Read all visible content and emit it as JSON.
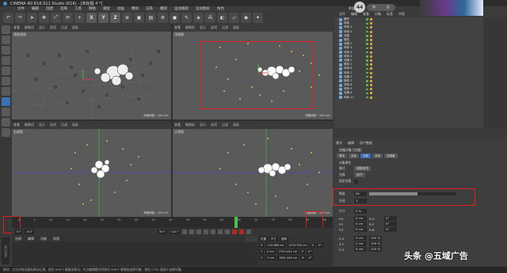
{
  "title": "CINEMA 4D R16.011 Studio (R16) - [未标题 4 *]",
  "menu": [
    "文件",
    "编辑",
    "创建",
    "选择",
    "工具",
    "网格",
    "捕捉",
    "动画",
    "模拟",
    "渲染",
    "雕刻",
    "运动跟踪",
    "运动图形",
    "角色",
    "流水线",
    "插件",
    "脚本",
    "窗口",
    "帮助"
  ],
  "toolbar": {
    "x": "X",
    "y": "Y",
    "z": "Z"
  },
  "viewports": [
    {
      "name": "透视视图",
      "grid": "网格间距 : 100 cm"
    },
    {
      "name": "顶视图",
      "grid": "网格间距 : 100 cm"
    },
    {
      "name": "右视图",
      "grid": "网格间距 : 100 cm"
    },
    {
      "name": "正视图",
      "grid": "网格间距 : 100 cm"
    }
  ],
  "viewport_menu": [
    "查看",
    "摄像机",
    "显示",
    "选项",
    "过滤",
    "面板"
  ],
  "timeline_ticks": [
    "0",
    "5",
    "10",
    "15",
    "20",
    "25",
    "30",
    "35",
    "40",
    "45",
    "50",
    "55",
    "60",
    "65",
    "70",
    "75",
    "80",
    "85",
    "90"
  ],
  "playback": {
    "start": "0 F",
    "current": "40 F",
    "end": "90 F",
    "fps": "120 F"
  },
  "materials_menu": [
    "创建",
    "编辑",
    "功能",
    "纹理"
  ],
  "coords": {
    "header": [
      "位置",
      "尺寸",
      "旋转"
    ],
    "rows": [
      [
        "X",
        "134.988 cm",
        "1070.935 cm",
        "H",
        "0°"
      ],
      [
        "Y",
        "0 cm",
        "2310.424 cm",
        "P",
        "0°"
      ],
      [
        "Z",
        "0 cm",
        "1651.449 cm",
        "B",
        "0°"
      ]
    ]
  },
  "status": "移动：点击并拖动鼠标移动元素。按住 SHIFT 键量化移动；节点编辑模式时按住 SHIFT 键增加选择对象；按住 CTRL 键减少选择对象。",
  "right_top": {
    "layout": "界面",
    "circle": "44",
    "pill": [
      "快",
      "加"
    ],
    "obj_menu": [
      "文件",
      "编辑",
      "查看",
      "对象",
      "标签",
      "书签"
    ]
  },
  "objects": [
    "圆环",
    "球体",
    "球体.1",
    "球体.2",
    "克隆",
    "随机",
    "克隆.1",
    "球体.3",
    "球体.4",
    "球体.5",
    "克隆.2",
    "随机.1",
    "球体.6",
    "球体.7",
    "克隆.3",
    "随机.2",
    "球体.8",
    "球体.9",
    "克隆.4",
    "球体.10"
  ],
  "attributes": {
    "menu": [
      "模式",
      "编辑",
      "用户数据"
    ],
    "name": "克隆对象 [克隆]",
    "tabs": [
      "基本",
      "坐标",
      "对象",
      "变换",
      "效果器"
    ],
    "section": "对象属性",
    "mode_label": "模式",
    "mode_value": "网格排列",
    "clone_label": "克隆",
    "clone_value": "迭代",
    "reset_label": "固定克隆",
    "count_label": "数量",
    "count_value": "64",
    "count_fill": 0.55,
    "radius_label": "半径",
    "radius_value": "1",
    "size_label": "尺寸",
    "size_value": "0 %",
    "rows": [
      [
        "P.X",
        "0 cm",
        "R.H",
        "0°"
      ],
      [
        "P.Y",
        "0 cm",
        "R.P",
        "0°"
      ],
      [
        "P.Z",
        "0 cm",
        "R.B",
        "0°"
      ]
    ],
    "rows2": [
      [
        "S.X",
        "0 cm",
        "100 %"
      ],
      [
        "S.Y",
        "0 cm",
        "100 %"
      ],
      [
        "S.Z",
        "0 cm",
        "100 %"
      ]
    ]
  },
  "watermark": "头条 @五域广告"
}
